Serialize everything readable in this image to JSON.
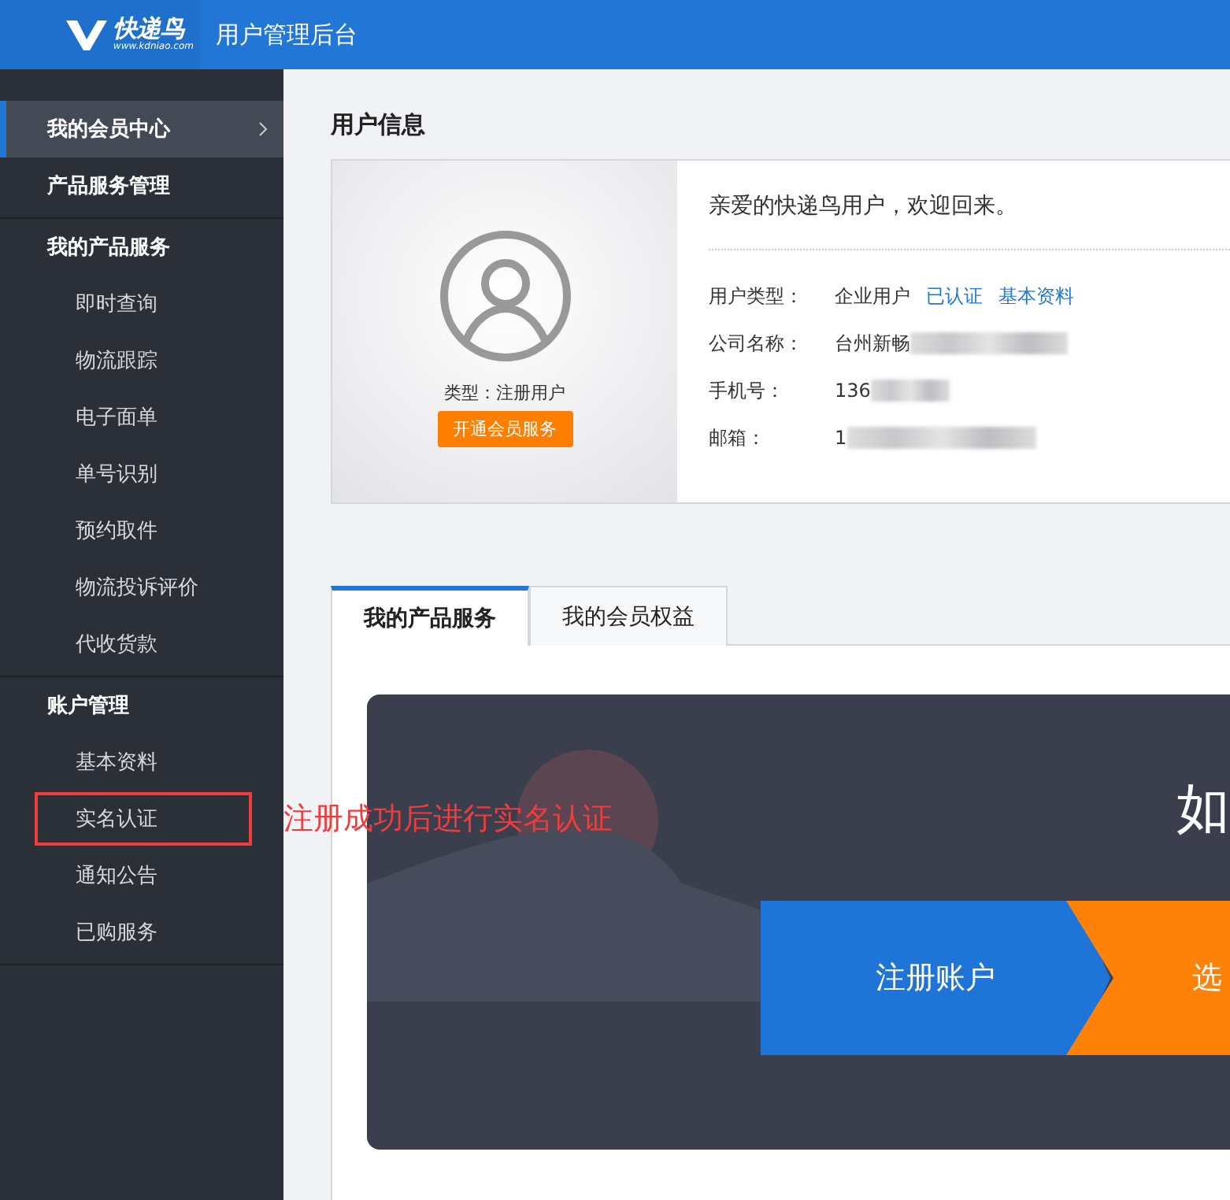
{
  "header": {
    "logo_text": "快递鸟",
    "logo_url": "www.kdniao.com",
    "title": "用户管理后台"
  },
  "sidebar": {
    "items": [
      {
        "label": "我的会员中心",
        "selected": true
      },
      {
        "label": "产品服务管理",
        "selected": false
      },
      {
        "label": "我的产品服务",
        "selected": false,
        "children": [
          {
            "label": "即时查询",
            "selected": false
          },
          {
            "label": "物流跟踪",
            "selected": false
          },
          {
            "label": "电子面单",
            "selected": false
          },
          {
            "label": "单号识别",
            "selected": false
          },
          {
            "label": "预约取件",
            "selected": false
          },
          {
            "label": "物流投诉评价",
            "selected": false
          },
          {
            "label": "代收货款",
            "selected": false
          }
        ]
      },
      {
        "label": "账户管理",
        "selected": false,
        "children": [
          {
            "label": "基本资料",
            "selected": false
          },
          {
            "label": "实名认证",
            "selected": false,
            "highlighted": true
          },
          {
            "label": "通知公告",
            "selected": false
          },
          {
            "label": "已购服务",
            "selected": false
          }
        ]
      }
    ]
  },
  "annotation": "注册成功后进行实名认证",
  "user_info": {
    "title": "用户信息",
    "type_label": "类型：注册用户",
    "upgrade_button": "开通会员服务",
    "welcome": "亲爱的快递鸟用户，欢迎回来。",
    "fields": [
      {
        "label": "用户类型：",
        "value": "企业用户",
        "links": [
          "已认证",
          "基本资料"
        ],
        "redacted": false
      },
      {
        "label": "公司名称：",
        "value": "台州新畅",
        "redacted": true
      },
      {
        "label": "手机号：",
        "value": "136",
        "redacted": true
      },
      {
        "label": "邮箱：",
        "value": "1",
        "redacted": true
      }
    ]
  },
  "tabs": [
    {
      "label": "我的产品服务",
      "selected": true
    },
    {
      "label": "我的会员权益",
      "selected": false
    }
  ],
  "banner": {
    "heading": "如",
    "steps": [
      {
        "label": "注册账户",
        "color": "#1f74d8"
      },
      {
        "label": "选",
        "color": "#ff8208"
      }
    ]
  }
}
